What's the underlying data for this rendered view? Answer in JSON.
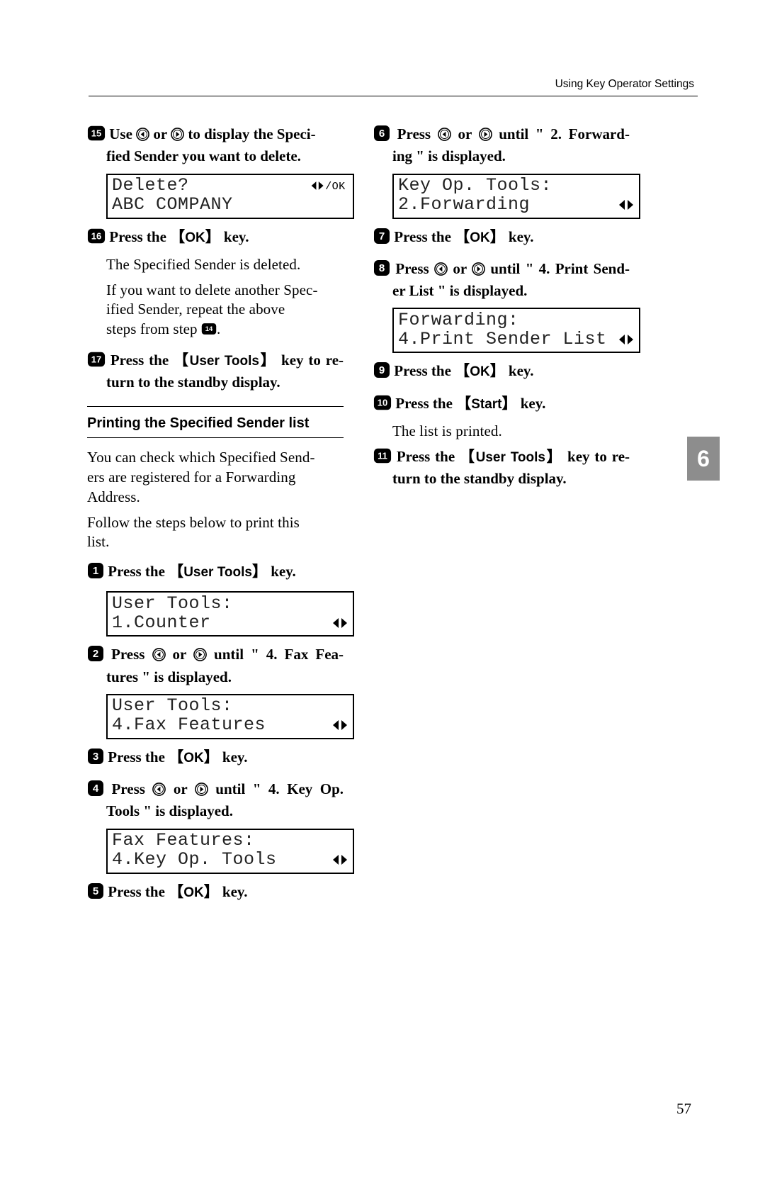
{
  "header": "Using Key Operator Settings",
  "page_number": "57",
  "side_tab": "6",
  "keys": {
    "ok": "OK",
    "user_tools": "User Tools",
    "start": "Start"
  },
  "left": {
    "s15": {
      "t1": "Use ",
      "t2": " or ",
      "t3": " to display the Speci-",
      "t4": "fied Sender you want to delete."
    },
    "lcd15": {
      "l1": "Delete?",
      "l2": "ABC COMPANY",
      "ind": "lrok"
    },
    "s16": {
      "t1": "Press the 【",
      "t2": "】 key."
    },
    "s16_body1": "The Specified Sender is deleted.",
    "s16_body2_a": "If you want to delete another Spec-",
    "s16_body2_b": "ified Sender, repeat the above",
    "s16_body2_c": "steps from step ",
    "s16_body2_d": ".",
    "s17": {
      "t1": "Press the 【",
      "t2": "】 key to re-",
      "t3": "turn to the standby display."
    },
    "subhead": "Printing the Specified Sender list",
    "intro1a": "You can check which Specified Send-",
    "intro1b": "ers are registered for a Forwarding",
    "intro1c": "Address.",
    "intro2a": "Follow the steps below to print this",
    "intro2b": "list.",
    "s1": {
      "t1": "Press the 【",
      "t2": "】 key."
    },
    "lcd1": {
      "l1": "User Tools:",
      "l2": "1.Counter",
      "ind": "lr"
    },
    "s2": {
      "t1": "Press ",
      "t2": " or ",
      "t3": " until \" 4. Fax Fea-",
      "t4": "tures \" is displayed."
    },
    "lcd2": {
      "l1": "User Tools:",
      "l2": "4.Fax Features",
      "ind": "lr"
    },
    "s3": {
      "t1": "Press the 【",
      "t2": "】 key."
    },
    "s4": {
      "t1": "Press ",
      "t2": " or ",
      "t3": " until \" 4. Key Op.",
      "t4": "Tools \" is displayed."
    },
    "lcd4": {
      "l1": "Fax Features:",
      "l2": "4.Key Op. Tools",
      "ind": "lr"
    },
    "s5": {
      "t1": "Press the 【",
      "t2": "】 key."
    }
  },
  "right": {
    "s6": {
      "t1": "Press ",
      "t2": " or ",
      "t3": " until \" 2. Forward-",
      "t4": "ing \" is displayed."
    },
    "lcd6": {
      "l1": "Key Op. Tools:",
      "l2": "2.Forwarding",
      "ind": "lr"
    },
    "s7": {
      "t1": "Press the 【",
      "t2": "】 key."
    },
    "s8": {
      "t1": "Press ",
      "t2": " or ",
      "t3": " until \" 4. Print Send-",
      "t4": "er List \" is displayed."
    },
    "lcd8": {
      "l1": "Forwarding:",
      "l2": "4.Print Sender List",
      "ind": "lr"
    },
    "s9": {
      "t1": "Press the 【",
      "t2": "】 key."
    },
    "s10": {
      "t1": "Press the 【",
      "t2": "】 key."
    },
    "s10_body": "The list is printed.",
    "s11": {
      "t1": "Press the 【",
      "t2": "】 key to re-",
      "t3": "turn to the standby display."
    }
  }
}
